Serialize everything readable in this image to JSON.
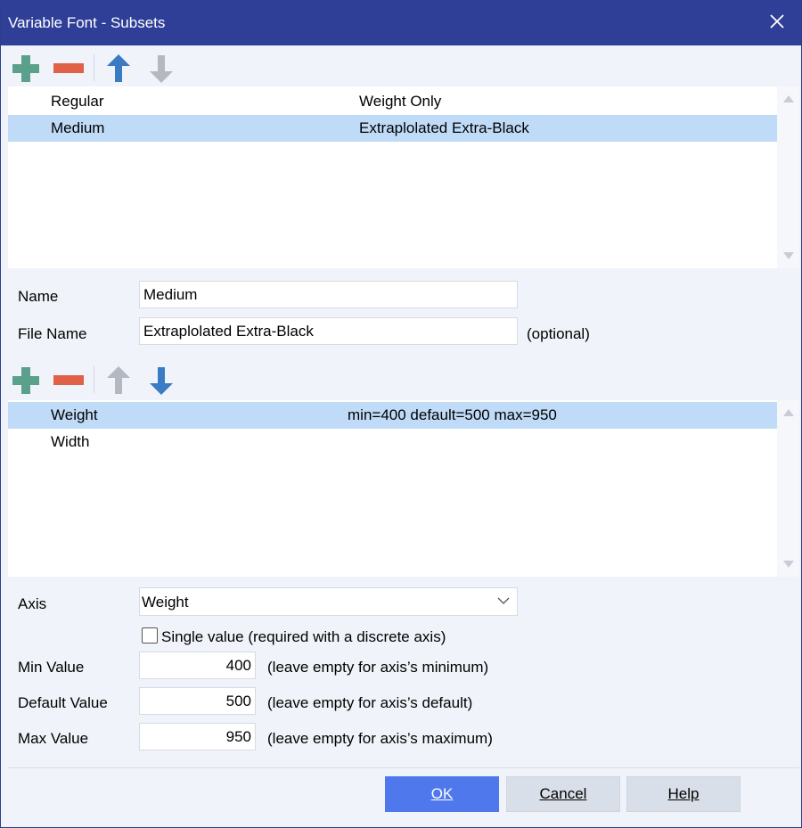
{
  "window": {
    "title": "Variable Font - Subsets",
    "close_glyph": "✕"
  },
  "subsets": {
    "rows": [
      {
        "name": "Regular",
        "file": "Weight Only",
        "selected": false
      },
      {
        "name": "Medium",
        "file": "Extraplolated Extra-Black",
        "selected": true
      }
    ]
  },
  "subset_form": {
    "name_label": "Name",
    "name_value": "Medium",
    "file_label": "File Name",
    "file_value": "Extraplolated Extra-Black",
    "file_hint": "(optional)"
  },
  "axes": {
    "rows": [
      {
        "name": "Weight",
        "range": "min=400 default=500 max=950",
        "selected": true
      },
      {
        "name": "Width",
        "range": "",
        "selected": false
      }
    ]
  },
  "axis_form": {
    "axis_label": "Axis",
    "axis_value": "Weight",
    "single_value_label": "Single value (required with a discrete axis)",
    "single_value_checked": false,
    "min_label": "Min Value",
    "min_value": "400",
    "min_hint": "(leave empty for axis’s minimum)",
    "default_label": "Default Value",
    "default_value": "500",
    "default_hint": "(leave empty for axis’s default)",
    "max_label": "Max Value",
    "max_value": "950",
    "max_hint": "(leave empty for axis’s maximum)"
  },
  "buttons": {
    "ok": "OK",
    "cancel": "Cancel",
    "help": "Help"
  },
  "colors": {
    "titlebar": "#2f3f97",
    "add_icon": "#5aa08a",
    "remove_icon": "#e06048",
    "arrow_active": "#3b7bc4",
    "arrow_disabled": "#b4b8c0",
    "selection": "#c0dbf7",
    "primary_button": "#4f78ec"
  },
  "icons": {
    "add": "plus-icon",
    "remove": "minus-icon",
    "up": "arrow-up-icon",
    "down": "arrow-down-icon",
    "close": "close-icon",
    "dropdown": "chevron-down-icon"
  }
}
